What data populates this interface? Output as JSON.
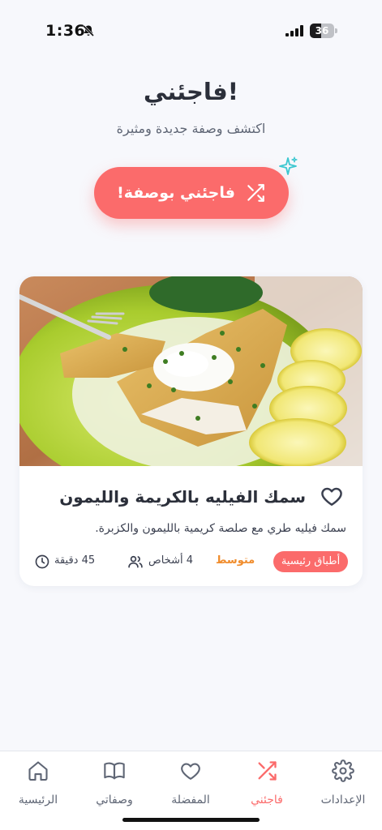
{
  "status_bar": {
    "time": "1:36",
    "battery": "36"
  },
  "header": {
    "title": "فاجئني!",
    "subtitle": "اكتشف وصفة جديدة ومثيرة"
  },
  "surprise_button": {
    "label": "فاجئني بوصفة!",
    "icon": "shuffle-icon"
  },
  "recipe": {
    "title": "سمك الفيليه بالكريمة والليمون",
    "description": "سمك فيليه طري مع صلصة كريمية بالليمون والكزبرة.",
    "category": "أطباق رئيسية",
    "difficulty": "متوسط",
    "servings": "4 أشخاص",
    "time": "45 دقيقة",
    "favorite": false
  },
  "nav": {
    "items": [
      {
        "label": "الرئيسية",
        "icon": "home-icon"
      },
      {
        "label": "وصفاتي",
        "icon": "book-icon"
      },
      {
        "label": "المفضلة",
        "icon": "heart-icon"
      },
      {
        "label": "فاجئني",
        "icon": "shuffle-icon",
        "active": true
      },
      {
        "label": "الإعدادات",
        "icon": "gear-icon"
      }
    ]
  },
  "colors": {
    "accent": "#fb6b6b",
    "difficulty": "#f08c2c",
    "background": "#f7f8fc",
    "text": "#2b2f3a"
  }
}
